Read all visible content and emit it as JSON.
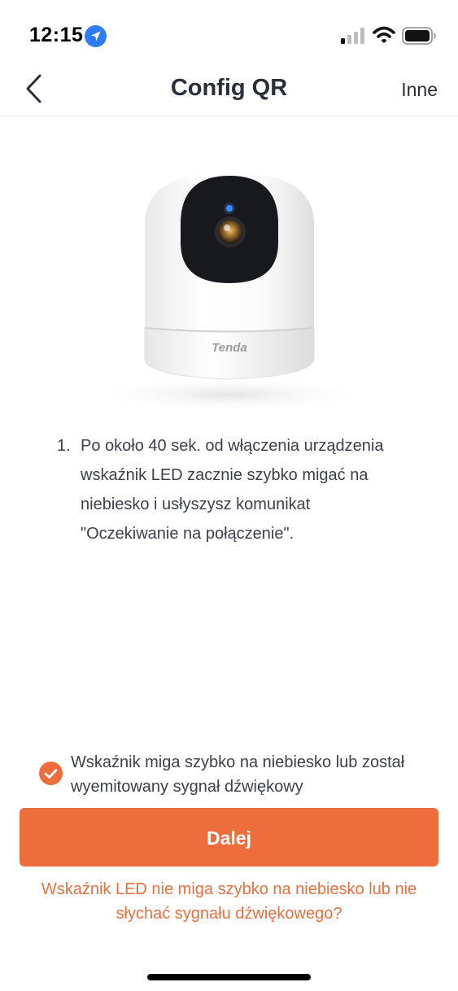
{
  "status_bar": {
    "time": "12:15",
    "icons": [
      "location-arrow-icon",
      "cellular-signal-icon",
      "wifi-icon",
      "battery-icon"
    ]
  },
  "nav": {
    "title": "Config QR",
    "other_label": "Inne",
    "back_icon": "chevron-left-icon"
  },
  "camera": {
    "brand": "Tenda"
  },
  "instructions": [
    {
      "number": "1.",
      "text": "Po około 40 sek. od włączenia urządzenia wskaźnik LED zacznie szybko migać na niebiesko i usłyszysz komunikat \"Oczekiwanie na połączenie\"."
    }
  ],
  "confirm": {
    "checked": true,
    "text": "Wskaźnik miga szybko na niebiesko lub został wyemitowany sygnał dźwiękowy"
  },
  "next_button_label": "Dalej",
  "help_link_text": "Wskaźnik LED nie miga szybko na niebiesko lub nie słychać sygnału dźwiękowego?",
  "colors": {
    "accent": "#ed6d3d",
    "text": "#2a2f3a",
    "location": "#2f7cf6",
    "led": "#3b8cff"
  }
}
